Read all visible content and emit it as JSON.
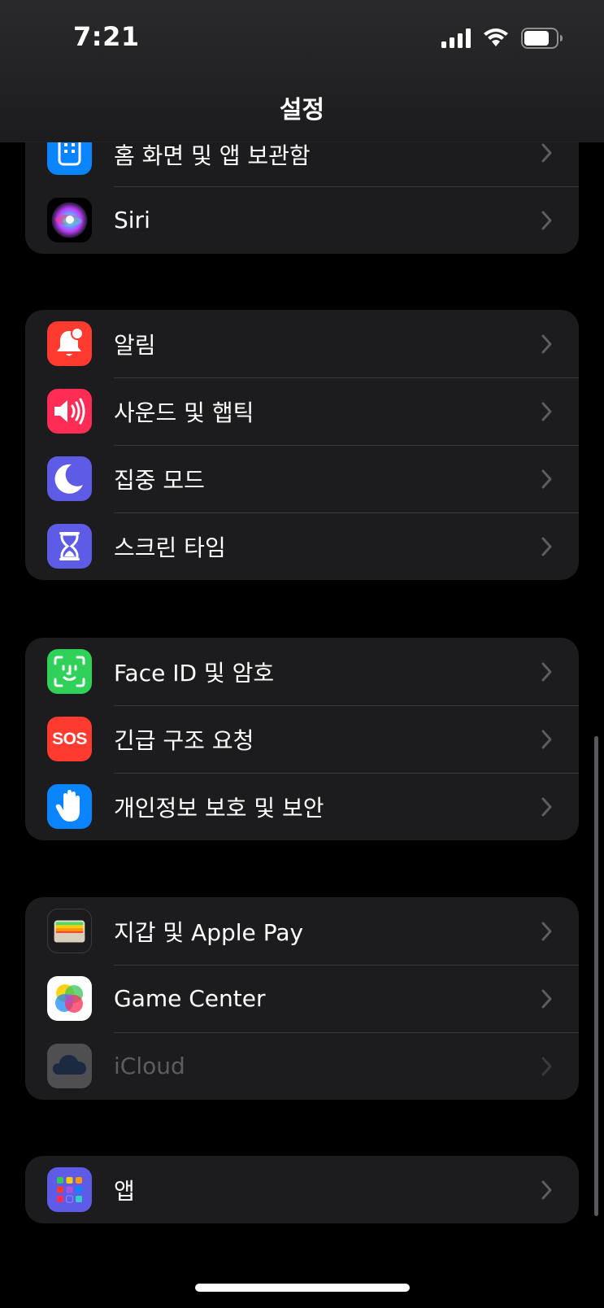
{
  "status": {
    "time": "7:21"
  },
  "nav": {
    "title": "설정"
  },
  "groups": [
    {
      "items": [
        {
          "label": "홈 화면 및 앱 보관함",
          "icon": "home-screen-icon",
          "color": "#0a84ff"
        },
        {
          "label": "Siri",
          "icon": "siri-icon",
          "color": "#000000"
        }
      ]
    },
    {
      "items": [
        {
          "label": "알림",
          "icon": "bell-icon",
          "color": "#ff3b30"
        },
        {
          "label": "사운드 및 햅틱",
          "icon": "speaker-icon",
          "color": "#ff2d55"
        },
        {
          "label": "집중 모드",
          "icon": "moon-icon",
          "color": "#5e5ce6"
        },
        {
          "label": "스크린 타임",
          "icon": "hourglass-icon",
          "color": "#5e5ce6"
        }
      ]
    },
    {
      "items": [
        {
          "label": "Face ID 및 암호",
          "icon": "face-id-icon",
          "color": "#30d158"
        },
        {
          "label": "긴급 구조 요청",
          "icon": "sos-icon",
          "color": "#ff3b30",
          "icon_text": "SOS"
        },
        {
          "label": "개인정보 보호 및 보안",
          "icon": "hand-icon",
          "color": "#0a84ff"
        }
      ]
    },
    {
      "items": [
        {
          "label": "지갑 및 Apple Pay",
          "icon": "wallet-icon",
          "color": "#1c1c1e"
        },
        {
          "label": "Game Center",
          "icon": "game-center-icon",
          "color": "#ffffff"
        },
        {
          "label": "iCloud",
          "icon": "icloud-icon",
          "color": "#3a3a3c",
          "dimmed": true
        }
      ]
    },
    {
      "items": [
        {
          "label": "앱",
          "icon": "apps-icon",
          "color": "#5e5ce6"
        }
      ]
    }
  ]
}
